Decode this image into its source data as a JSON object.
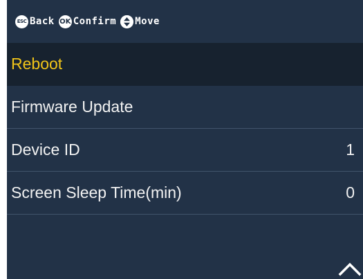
{
  "hints": [
    {
      "key": "ESC",
      "label": "Back"
    },
    {
      "key": "OK",
      "label": "Confirm"
    },
    {
      "key": "move-updown-icon",
      "label": "Move"
    }
  ],
  "menu": {
    "items": [
      {
        "label": "Reboot",
        "value": "",
        "selected": true
      },
      {
        "label": "Firmware Update",
        "value": ""
      },
      {
        "label": "Device ID",
        "value": "1"
      },
      {
        "label": "Screen Sleep Time(min)",
        "value": "0"
      }
    ]
  },
  "icons": {
    "scroll_indicator": "chevron-up-icon"
  },
  "colors": {
    "background": "#223247",
    "selected_background": "#17222f",
    "selected_text": "#f0c419",
    "text": "#f2f2f2",
    "divider": "#41546b"
  }
}
